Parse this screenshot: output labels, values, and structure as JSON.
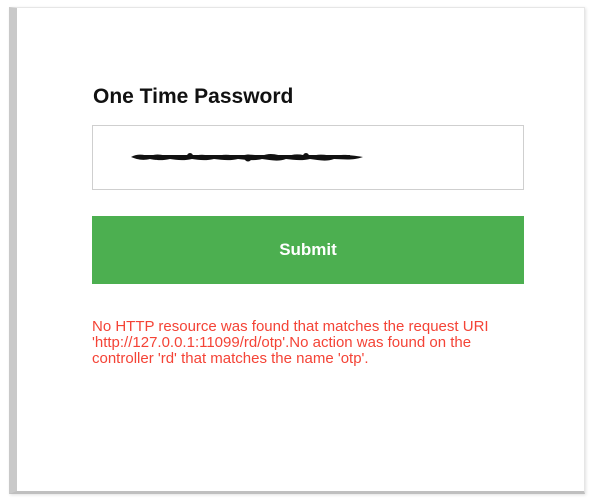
{
  "form": {
    "title": "One Time Password",
    "otp_input": {
      "value": "",
      "placeholder": "",
      "masked": true
    },
    "submit_label": "Submit",
    "error_message": "No HTTP resource was found that matches the request URI 'http://127.0.0.1:11099/rd/otp'.No action was found on the controller 'rd' that matches the name 'otp'."
  },
  "colors": {
    "accent": "#4caf50",
    "error": "#f44336",
    "title": "#111111",
    "border": "#cfcfcf"
  }
}
